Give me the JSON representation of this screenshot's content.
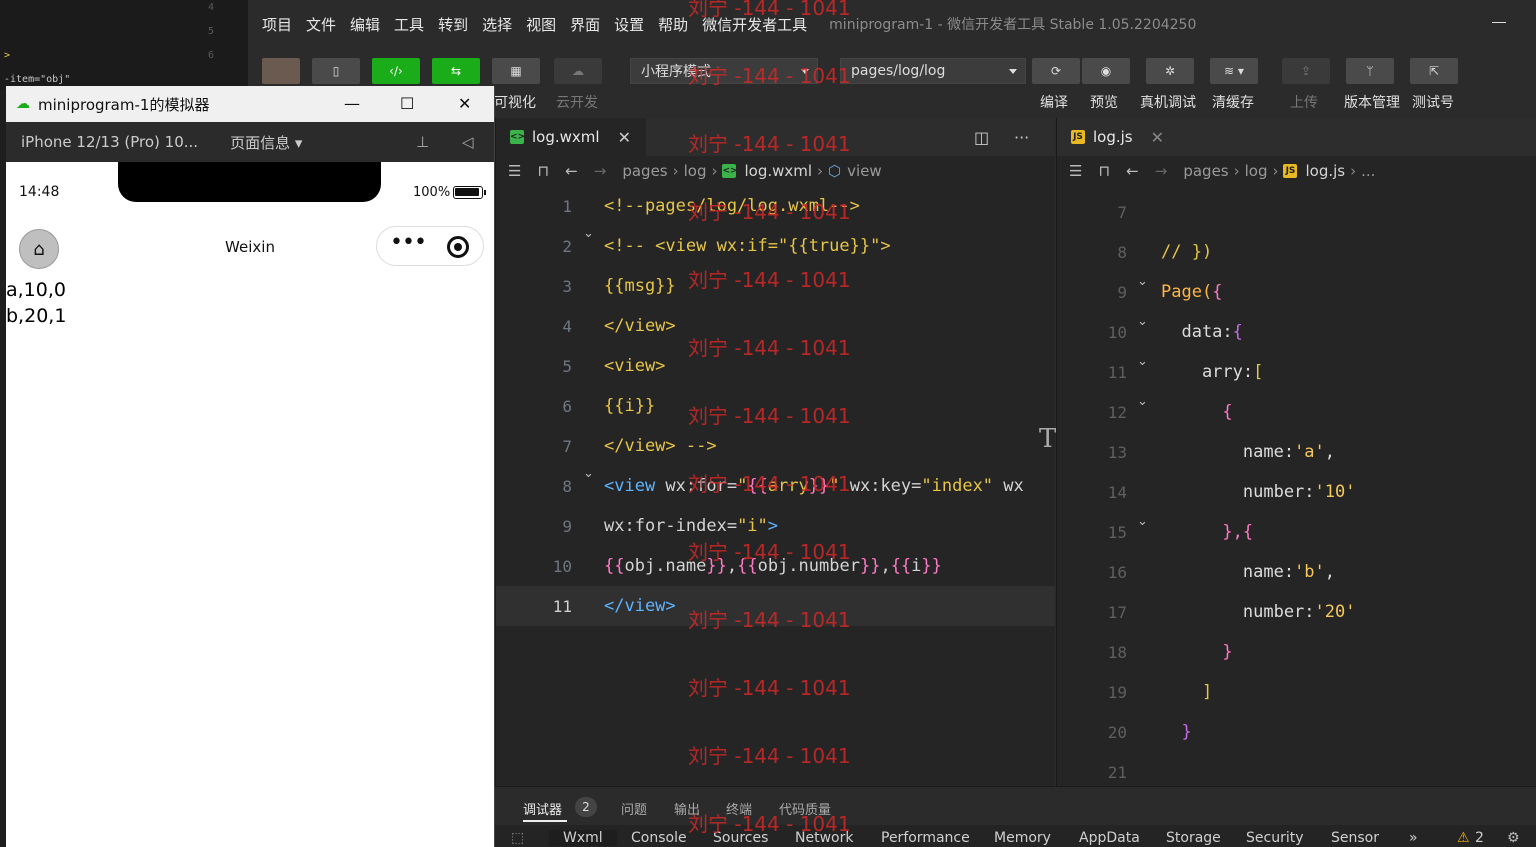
{
  "background": {
    "line_numbers": [
      "4",
      "5",
      "6"
    ],
    "fragments": [
      ">",
      "-item=\"obj\""
    ]
  },
  "menubar": {
    "items": [
      "项目",
      "文件",
      "编辑",
      "工具",
      "转到",
      "选择",
      "视图",
      "界面",
      "设置",
      "帮助",
      "微信开发者工具"
    ],
    "window_title": "miniprogram-1 - 微信开发者工具 Stable 1.05.2204250"
  },
  "toolbar": {
    "labels": {
      "visual": "可视化",
      "cloud": "云开发",
      "compile": "编译",
      "preview": "预览",
      "remote_debug": "真机调试",
      "clear_cache": "清缓存",
      "upload": "上传",
      "version": "版本管理",
      "test": "测试号"
    },
    "mode_select": "小程序模式",
    "page_select": "pages/log/log"
  },
  "simulator": {
    "title": "miniprogram-1的模拟器",
    "device": "iPhone 12/13 (Pro) 10...",
    "page_info": "页面信息 ▾",
    "status_time": "14:48",
    "battery": "100%",
    "nav_title": "Weixin",
    "rows": [
      "a,10,0",
      "b,20,1"
    ]
  },
  "editor_left": {
    "tab": "log.wxml",
    "breadcrumb": [
      "pages",
      "log",
      "log.wxml",
      "view"
    ],
    "lines": [
      {
        "n": "1",
        "parts": [
          [
            "c-comment",
            "<!--pages/log/log.wxml-->"
          ]
        ]
      },
      {
        "n": "2",
        "parts": [
          [
            "c-comment",
            "<!-- <view wx:if=\"{{true}}\">"
          ]
        ]
      },
      {
        "n": "3",
        "parts": [
          [
            "c-comment",
            "{{msg}}"
          ]
        ]
      },
      {
        "n": "4",
        "parts": [
          [
            "c-comment",
            "</view>"
          ]
        ]
      },
      {
        "n": "5",
        "parts": [
          [
            "c-comment",
            "<view>"
          ]
        ]
      },
      {
        "n": "6",
        "parts": [
          [
            "c-comment",
            "{{i}}"
          ]
        ]
      },
      {
        "n": "7",
        "parts": [
          [
            "c-comment",
            "</view> -->"
          ]
        ]
      },
      {
        "n": "8",
        "parts": [
          [
            "c-tag",
            "<view "
          ],
          [
            "c-attr",
            "wx:for="
          ],
          [
            "c-str",
            "\""
          ],
          [
            "c-brace",
            "{{"
          ],
          [
            "c-str",
            "arry"
          ],
          [
            "c-brace",
            "}}"
          ],
          [
            "c-str",
            "\""
          ],
          [
            "c-attr",
            " wx:key="
          ],
          [
            "c-str",
            "\"index\""
          ],
          [
            "c-attr",
            " wx"
          ]
        ]
      },
      {
        "n": "9",
        "parts": [
          [
            "c-attr",
            "wx:for-index="
          ],
          [
            "c-str",
            "\"i\""
          ],
          [
            "c-tag",
            ">"
          ]
        ]
      },
      {
        "n": "10",
        "parts": [
          [
            "c-brace",
            "{{"
          ],
          [
            "c-text",
            "obj.name"
          ],
          [
            "c-brace",
            "}}"
          ],
          [
            "c-text",
            ","
          ],
          [
            "c-brace",
            "{{"
          ],
          [
            "c-text",
            "obj.number"
          ],
          [
            "c-brace",
            "}}"
          ],
          [
            "c-text",
            ","
          ],
          [
            "c-brace",
            "{{"
          ],
          [
            "c-text",
            "i"
          ],
          [
            "c-brace",
            "}}"
          ]
        ]
      },
      {
        "n": "11",
        "parts": [
          [
            "c-tag",
            "</view>"
          ]
        ]
      }
    ]
  },
  "editor_right": {
    "tab": "log.js",
    "breadcrumb": [
      "pages",
      "log",
      "log.js",
      "..."
    ],
    "lines": [
      {
        "n": "7",
        "parts": []
      },
      {
        "n": "8",
        "parts": [
          [
            "c-comment",
            "// })"
          ]
        ]
      },
      {
        "n": "9",
        "parts": [
          [
            "c-fn",
            "Page("
          ],
          [
            "c-brace",
            "{"
          ]
        ]
      },
      {
        "n": "10",
        "parts": [
          [
            "c-key",
            "  data:"
          ],
          [
            "c-brace2",
            "{"
          ]
        ]
      },
      {
        "n": "11",
        "parts": [
          [
            "c-key",
            "    arry:"
          ],
          [
            "c-str",
            "["
          ]
        ]
      },
      {
        "n": "12",
        "parts": [
          [
            "c-brace",
            "      {"
          ]
        ]
      },
      {
        "n": "13",
        "parts": [
          [
            "c-key",
            "        name:"
          ],
          [
            "c-strr",
            "'a'"
          ],
          [
            "c-key",
            ","
          ]
        ]
      },
      {
        "n": "14",
        "parts": [
          [
            "c-key",
            "        number:"
          ],
          [
            "c-strr",
            "'10'"
          ]
        ]
      },
      {
        "n": "15",
        "parts": [
          [
            "c-brace",
            "      },{"
          ]
        ]
      },
      {
        "n": "16",
        "parts": [
          [
            "c-key",
            "        name:"
          ],
          [
            "c-strr",
            "'b'"
          ],
          [
            "c-key",
            ","
          ]
        ]
      },
      {
        "n": "17",
        "parts": [
          [
            "c-key",
            "        number:"
          ],
          [
            "c-strr",
            "'20'"
          ]
        ]
      },
      {
        "n": "18",
        "parts": [
          [
            "c-brace",
            "      }"
          ]
        ]
      },
      {
        "n": "19",
        "parts": [
          [
            "c-str",
            "    ]"
          ]
        ]
      },
      {
        "n": "20",
        "parts": [
          [
            "c-brace2",
            "  }"
          ]
        ]
      },
      {
        "n": "21",
        "parts": []
      }
    ]
  },
  "bottom_panel": {
    "tabs": [
      "调试器",
      "问题",
      "输出",
      "终端",
      "代码质量"
    ],
    "debugger_badge": "2",
    "devtools_tabs": [
      "Wxml",
      "Console",
      "Sources",
      "Network",
      "Performance",
      "Memory",
      "AppData",
      "Storage",
      "Security",
      "Sensor",
      "»"
    ],
    "warning_count": "2"
  },
  "watermark": "刘宁 -144 - 1041"
}
